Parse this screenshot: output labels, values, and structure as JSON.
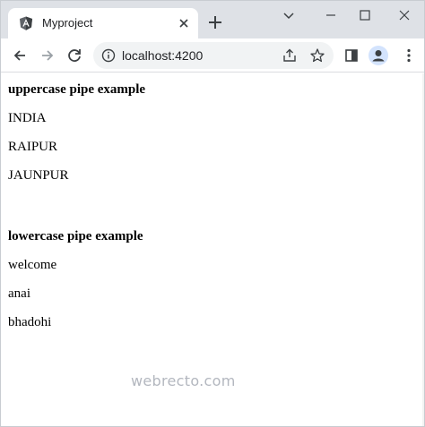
{
  "browser": {
    "tab_title": "Myproject",
    "url": "localhost:4200"
  },
  "page": {
    "uppercase_heading": "uppercase pipe example",
    "uppercase_items": [
      "INDIA",
      "RAIPUR",
      "JAUNPUR"
    ],
    "lowercase_heading": "lowercase pipe example",
    "lowercase_items": [
      "welcome",
      "anai",
      "bhadohi"
    ]
  },
  "watermark": "webrecto.com",
  "colors": {
    "tabstrip_bg": "#dee1e6",
    "omnibox_bg": "#f1f3f4",
    "angular_red": "#c3002f"
  },
  "icons": [
    "angular-logo-icon",
    "close-icon",
    "plus-icon",
    "minimize-icon",
    "maximize-icon",
    "chevron-down-icon",
    "back-icon",
    "forward-icon",
    "reload-icon",
    "info-icon",
    "share-icon",
    "star-icon",
    "sidepanel-icon",
    "profile-icon",
    "kebab-menu-icon"
  ]
}
